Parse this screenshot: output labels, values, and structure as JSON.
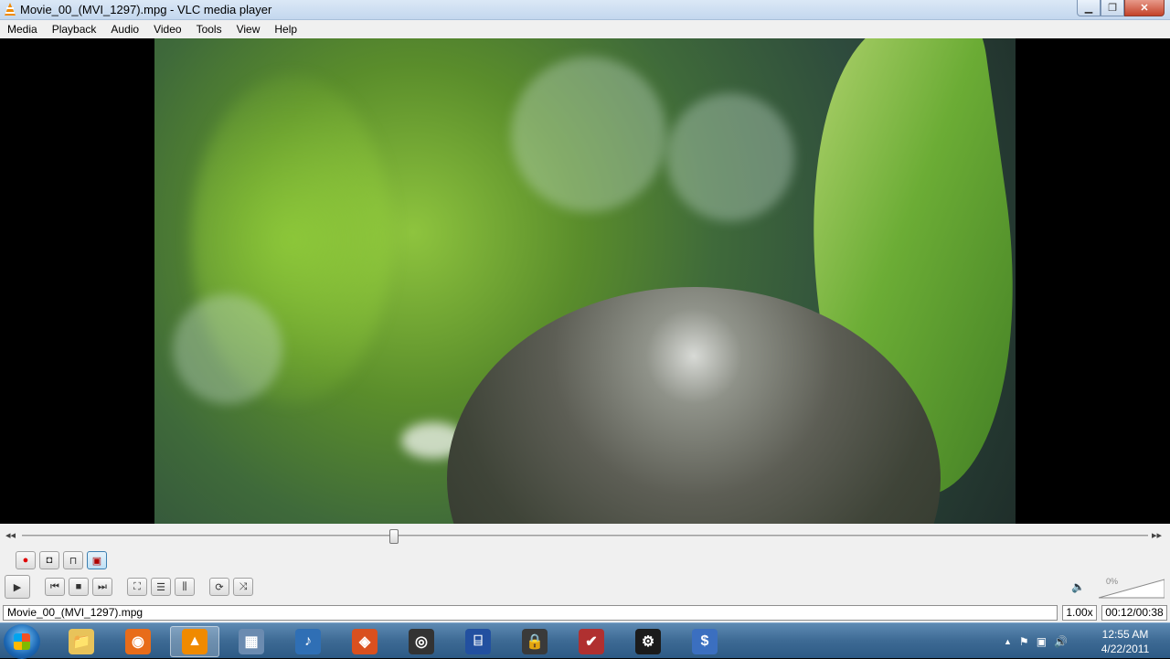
{
  "window": {
    "title": "Movie_00_(MVI_1297).mpg - VLC media player",
    "min_glyph": "▁",
    "max_glyph": "❐",
    "close_glyph": "✕"
  },
  "menu": [
    "Media",
    "Playback",
    "Audio",
    "Video",
    "Tools",
    "View",
    "Help"
  ],
  "seek": {
    "position_fraction": 0.33,
    "back_glyph": "◂◂",
    "fwd_glyph": "▸▸"
  },
  "advanced_controls": [
    {
      "icon": "record-icon",
      "glyph": "●"
    },
    {
      "icon": "snapshot-icon",
      "glyph": "◘"
    },
    {
      "icon": "loop-ab-icon",
      "glyph": "⊓"
    },
    {
      "icon": "frame-by-frame-icon",
      "glyph": "▣"
    }
  ],
  "playback_controls": {
    "play_glyph": "▶",
    "prev_glyph": "⏮",
    "stop_glyph": "■",
    "next_glyph": "⏭",
    "fullscreen_glyph": "⛶",
    "playlist_glyph": "☰",
    "extended_glyph": "⫼",
    "loop_glyph": "⟳",
    "random_glyph": "⤨"
  },
  "volume": {
    "percent_label": "0%",
    "speaker_glyph": "🔈",
    "level_percent": 0
  },
  "status": {
    "filename": "Movie_00_(MVI_1297).mpg",
    "speed": "1.00x",
    "time": "00:12/00:38"
  },
  "taskbar": {
    "items": [
      {
        "icon": "explorer-icon",
        "color": "#e8c35a",
        "glyph": "📁"
      },
      {
        "icon": "firefox-icon",
        "color": "#e86c1a",
        "glyph": "◉"
      },
      {
        "icon": "vlc-icon",
        "color": "#f08a00",
        "glyph": "▲",
        "active": true
      },
      {
        "icon": "monitor-icon",
        "color": "#6b8bb0",
        "glyph": "▦"
      },
      {
        "icon": "music-icon",
        "color": "#2f6fb5",
        "glyph": "♪"
      },
      {
        "icon": "eye-app-icon",
        "color": "#d9501f",
        "glyph": "◈"
      },
      {
        "icon": "target-app-icon",
        "color": "#333333",
        "glyph": "◎"
      },
      {
        "icon": "usb-icon",
        "color": "#2250a0",
        "glyph": "⌸"
      },
      {
        "icon": "lock-app-icon",
        "color": "#3a3a3a",
        "glyph": "🔒"
      },
      {
        "icon": "clipboard-icon",
        "color": "#b03030",
        "glyph": "✔"
      },
      {
        "icon": "steam-icon",
        "color": "#1b1b1b",
        "glyph": "⚙"
      },
      {
        "icon": "dollar-app-icon",
        "color": "#3b6fc0",
        "glyph": "$"
      }
    ],
    "tray": {
      "up_glyph": "▲",
      "flag_glyph": "⚑",
      "network_glyph": "▣",
      "volume_glyph": "🔊"
    },
    "clock_time": "12:55 AM",
    "clock_date": "4/22/2011"
  }
}
